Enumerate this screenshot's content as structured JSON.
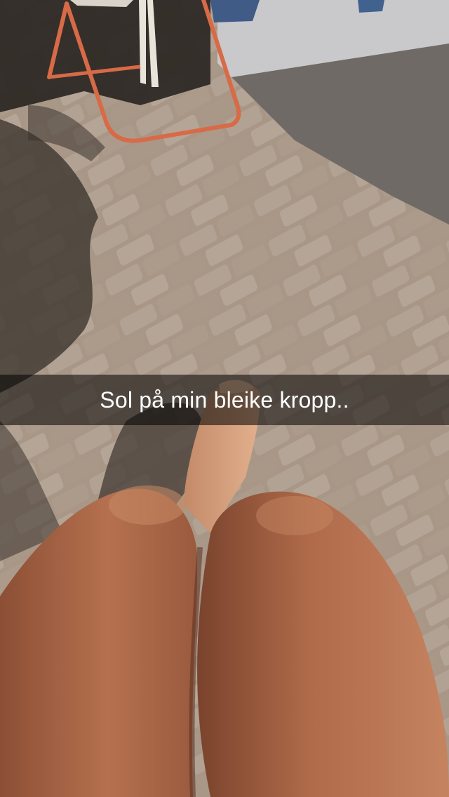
{
  "snap": {
    "caption": "Sol på min bleike kropp.."
  },
  "photo": {
    "palette": {
      "pavers": "#a89787",
      "paver_joint": "#6f6257",
      "asphalt": "#6f6a65",
      "wall": "#c9c9cb",
      "rack_frame": "#d86a47",
      "skin": "#b7704f",
      "shadow": "#3a332d"
    }
  }
}
